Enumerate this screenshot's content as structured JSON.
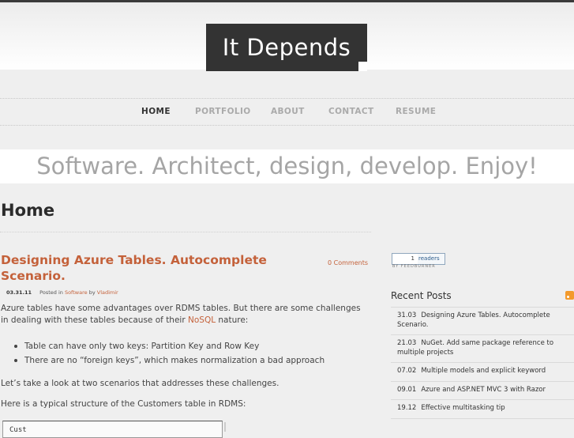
{
  "site": {
    "logo": "It Depends"
  },
  "nav": [
    {
      "label": "HOME",
      "active": true
    },
    {
      "label": "PORTFOLIO"
    },
    {
      "label": "ABOUT"
    },
    {
      "label": "CONTACT"
    },
    {
      "label": "RESUME"
    }
  ],
  "tagline": "Software. Architect, design, develop. Enjoy!",
  "page_title": "Home",
  "post": {
    "title": "Designing Azure Tables. Autocomplete Scenario.",
    "comments": "0 Comments",
    "date": "03.31.11",
    "posted_in": "Posted in",
    "category": "Software",
    "by": "by",
    "author": "Vladimir",
    "p1_start": "Azure tables have some advantages over RDMS tables. But there are some challenges in dealing with these tables because of their ",
    "p1_link": "NoSQL",
    "p1_end": " nature:",
    "bullets": [
      "Table can have only two keys: Partition Key and Row Key",
      "There are no “foreign keys”, which makes normalization a bad approach"
    ],
    "p2": "Let’s take a look at two scenarios that addresses these challenges.",
    "p3": "Here is a typical structure of the Customers table in RDMS:",
    "code_start": "Cust"
  },
  "feed": {
    "count": "1",
    "label": "readers",
    "by": "BY FEEDBURNER"
  },
  "sidebar": {
    "recent_title": "Recent Posts",
    "recent": [
      {
        "date": "31.03",
        "title": "Designing Azure Tables. Autocomplete Scenario."
      },
      {
        "date": "21.03",
        "title": "NuGet. Add same package reference to multiple projects"
      },
      {
        "date": "07.02",
        "title": "Multiple models and explicit keyword"
      },
      {
        "date": "09.01",
        "title": "Azure and ASP.NET MVC 3 with Razor"
      },
      {
        "date": "19.12",
        "title": "Effective multitasking tip"
      }
    ]
  }
}
